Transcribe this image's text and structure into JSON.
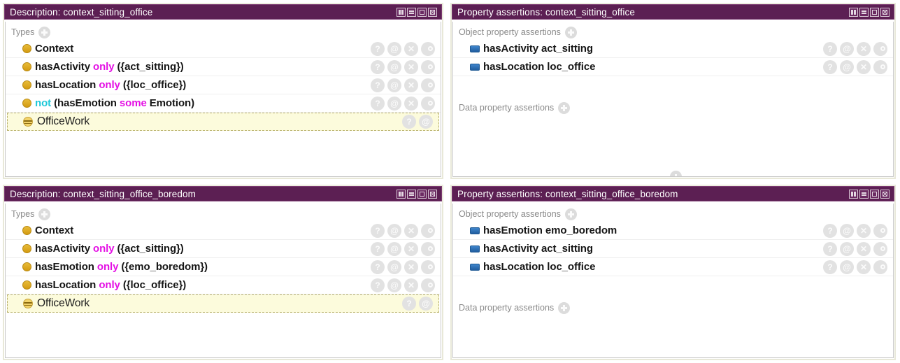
{
  "window_buttons": [
    {
      "name": "split-view",
      "title": "Split view"
    },
    {
      "name": "minimize",
      "title": "Minimize"
    },
    {
      "name": "maximize",
      "title": "Maximize"
    },
    {
      "name": "close",
      "title": "Close"
    }
  ],
  "action_icons": [
    "?",
    "@",
    "✕",
    "o"
  ],
  "colors": {
    "titlebar_bg": "#5c1f53",
    "titlebar_text": "#ffffff",
    "keyword_only": "#e40fe4",
    "keyword_some": "#e40fe4",
    "keyword_not": "#1ec8d8",
    "class_icon": "#e0a81d",
    "object_property_icon": "#2f72b8",
    "selected_row_bg": "#fcfbdc",
    "panel_border": "#e8e8d8"
  },
  "panels": {
    "description_office": {
      "title": "Description: context_sitting_office",
      "section_label": "Types",
      "rows": [
        {
          "icon": "class-icon",
          "parts": [
            {
              "t": "Context",
              "k": "plain"
            }
          ],
          "actions": [
            "?",
            "@",
            "✕",
            "o"
          ],
          "selected": false
        },
        {
          "icon": "class-icon",
          "parts": [
            {
              "t": "hasActivity ",
              "k": "plain"
            },
            {
              "t": "only",
              "k": "only"
            },
            {
              "t": " ({act_sitting})",
              "k": "plain"
            }
          ],
          "actions": [
            "?",
            "@",
            "✕",
            "o"
          ],
          "selected": false
        },
        {
          "icon": "class-icon",
          "parts": [
            {
              "t": "hasLocation ",
              "k": "plain"
            },
            {
              "t": "only",
              "k": "only"
            },
            {
              "t": " ({loc_office})",
              "k": "plain"
            }
          ],
          "actions": [
            "?",
            "@",
            "✕",
            "o"
          ],
          "selected": false
        },
        {
          "icon": "class-icon",
          "parts": [
            {
              "t": "not",
              "k": "not"
            },
            {
              "t": " (hasEmotion ",
              "k": "plain"
            },
            {
              "t": "some",
              "k": "some"
            },
            {
              "t": " Emotion)",
              "k": "plain"
            }
          ],
          "actions": [
            "?",
            "@",
            "✕",
            "o"
          ],
          "selected": false
        },
        {
          "icon": "inferred-class-icon",
          "parts": [
            {
              "t": "OfficeWork",
              "k": "plain"
            }
          ],
          "actions": [
            "?",
            "@"
          ],
          "selected": true
        }
      ]
    },
    "assertions_office": {
      "title": "Property assertions: context_sitting_office",
      "object_label": "Object property assertions",
      "data_label": "Data property assertions",
      "object_rows": [
        {
          "icon": "object-property-icon",
          "parts": [
            {
              "t": "hasActivity  act_sitting",
              "k": "plain"
            }
          ],
          "actions": [
            "?",
            "@",
            "✕",
            "o"
          ]
        },
        {
          "icon": "object-property-icon",
          "parts": [
            {
              "t": "hasLocation  loc_office",
              "k": "plain"
            }
          ],
          "actions": [
            "?",
            "@",
            "✕",
            "o"
          ]
        }
      ],
      "data_rows": [],
      "has_cut_off_plus": true
    },
    "description_boredom": {
      "title": "Description: context_sitting_office_boredom",
      "section_label": "Types",
      "rows": [
        {
          "icon": "class-icon",
          "parts": [
            {
              "t": "Context",
              "k": "plain"
            }
          ],
          "actions": [
            "?",
            "@",
            "✕",
            "o"
          ],
          "selected": false
        },
        {
          "icon": "class-icon",
          "parts": [
            {
              "t": "hasActivity ",
              "k": "plain"
            },
            {
              "t": "only",
              "k": "only"
            },
            {
              "t": " ({act_sitting})",
              "k": "plain"
            }
          ],
          "actions": [
            "?",
            "@",
            "✕",
            "o"
          ],
          "selected": false
        },
        {
          "icon": "class-icon",
          "parts": [
            {
              "t": "hasEmotion ",
              "k": "plain"
            },
            {
              "t": "only",
              "k": "only"
            },
            {
              "t": " ({emo_boredom})",
              "k": "plain"
            }
          ],
          "actions": [
            "?",
            "@",
            "✕",
            "o"
          ],
          "selected": false
        },
        {
          "icon": "class-icon",
          "parts": [
            {
              "t": "hasLocation ",
              "k": "plain"
            },
            {
              "t": "only",
              "k": "only"
            },
            {
              "t": " ({loc_office})",
              "k": "plain"
            }
          ],
          "actions": [
            "?",
            "@",
            "✕",
            "o"
          ],
          "selected": false
        },
        {
          "icon": "inferred-class-icon",
          "parts": [
            {
              "t": "OfficeWork",
              "k": "plain"
            }
          ],
          "actions": [
            "?",
            "@"
          ],
          "selected": true
        }
      ]
    },
    "assertions_boredom": {
      "title": "Property assertions: context_sitting_office_boredom",
      "object_label": "Object property assertions",
      "data_label": "Data property assertions",
      "object_rows": [
        {
          "icon": "object-property-icon",
          "parts": [
            {
              "t": "hasEmotion  emo_boredom",
              "k": "plain"
            }
          ],
          "actions": [
            "?",
            "@",
            "✕",
            "o"
          ]
        },
        {
          "icon": "object-property-icon",
          "parts": [
            {
              "t": "hasActivity  act_sitting",
              "k": "plain"
            }
          ],
          "actions": [
            "?",
            "@",
            "✕",
            "o"
          ]
        },
        {
          "icon": "object-property-icon",
          "parts": [
            {
              "t": "hasLocation  loc_office",
              "k": "plain"
            }
          ],
          "actions": [
            "?",
            "@",
            "✕",
            "o"
          ]
        }
      ],
      "data_rows": [],
      "has_cut_off_plus": false
    }
  }
}
